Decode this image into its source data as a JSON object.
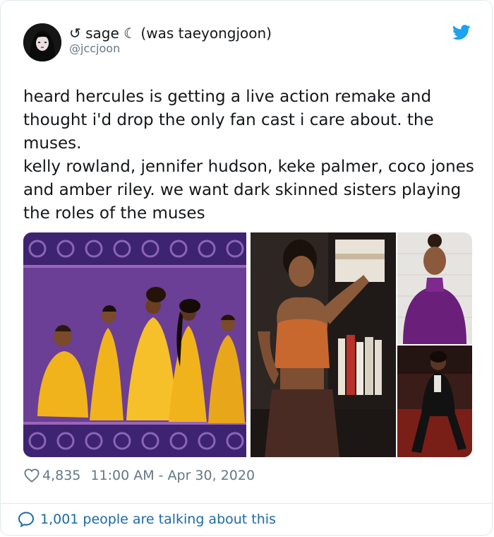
{
  "tweet": {
    "display_name": "↺ sage ☾ (was taeyongjoon)",
    "handle": "@jccjoon",
    "text_lines": [
      "heard hercules is getting a live action remake and thought i'd drop the only fan cast i care about. the muses.",
      "kelly rowland, jennifer hudson, keke palmer, coco jones and amber riley. we want dark skinned sisters playing the roles of the muses"
    ],
    "likes": "4,835",
    "time": "11:00 AM - Apr 30, 2020",
    "talking": "1,001 people are talking about this"
  },
  "media": {
    "images": [
      {
        "name": "muses-illustration",
        "dominant_color": "#6b3f95"
      },
      {
        "name": "woman-orange-top-photo",
        "dominant_color": "#3a2e2a"
      },
      {
        "name": "woman-purple-top-photo",
        "dominant_color": "#6a1f7a"
      },
      {
        "name": "woman-black-suit-photo",
        "dominant_color": "#2a1a18"
      }
    ]
  },
  "colors": {
    "twitter_blue": "#1da1f2",
    "link_blue": "#1b6aa5",
    "muted_gray": "#657786"
  },
  "icons": [
    "twitter-bird-icon",
    "heart-icon",
    "comment-bubble-icon"
  ]
}
